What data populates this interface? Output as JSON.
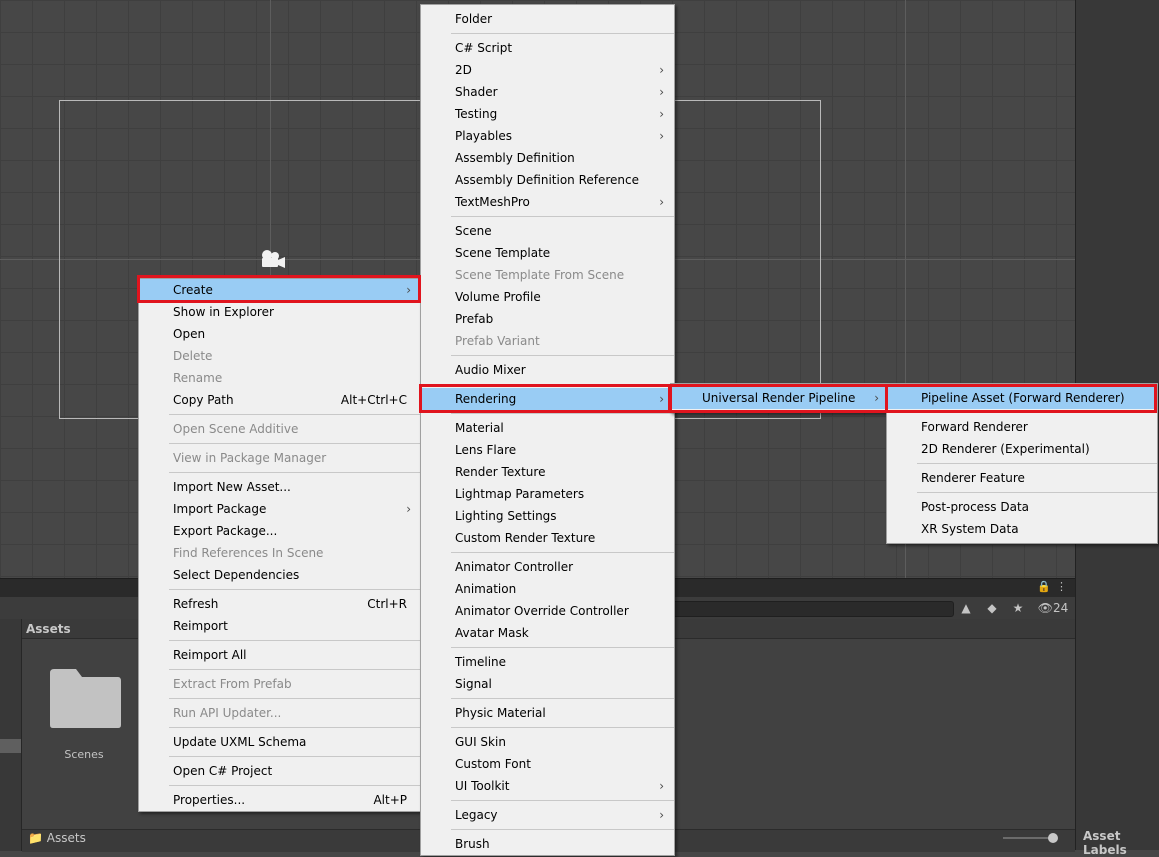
{
  "project": {
    "assets_title": "Assets",
    "folder_label": "Scenes",
    "bottom_path": "Assets",
    "hidden_count": "24"
  },
  "inspector": {
    "asset_labels": "Asset Labels"
  },
  "context_menu": {
    "items": [
      {
        "label": "Create",
        "arrow": "›",
        "state": "highlight"
      },
      {
        "label": "Show in Explorer"
      },
      {
        "label": "Open"
      },
      {
        "label": "Delete",
        "state": "disabled"
      },
      {
        "label": "Rename",
        "state": "disabled"
      },
      {
        "label": "Copy Path",
        "shortcut": "Alt+Ctrl+C"
      },
      {
        "sep": true
      },
      {
        "label": "Open Scene Additive",
        "state": "disabled"
      },
      {
        "sep": true
      },
      {
        "label": "View in Package Manager",
        "state": "disabled"
      },
      {
        "sep": true
      },
      {
        "label": "Import New Asset..."
      },
      {
        "label": "Import Package",
        "arrow": "›"
      },
      {
        "label": "Export Package..."
      },
      {
        "label": "Find References In Scene",
        "state": "disabled"
      },
      {
        "label": "Select Dependencies"
      },
      {
        "sep": true
      },
      {
        "label": "Refresh",
        "shortcut": "Ctrl+R"
      },
      {
        "label": "Reimport"
      },
      {
        "sep": true
      },
      {
        "label": "Reimport All"
      },
      {
        "sep": true
      },
      {
        "label": "Extract From Prefab",
        "state": "disabled"
      },
      {
        "sep": true
      },
      {
        "label": "Run API Updater...",
        "state": "disabled"
      },
      {
        "sep": true
      },
      {
        "label": "Update UXML Schema"
      },
      {
        "sep": true
      },
      {
        "label": "Open C# Project"
      },
      {
        "sep": true
      },
      {
        "label": "Properties...",
        "shortcut": "Alt+P"
      }
    ]
  },
  "create_menu": {
    "items": [
      {
        "label": "Folder"
      },
      {
        "sep": true
      },
      {
        "label": "C# Script"
      },
      {
        "label": "2D",
        "arrow": "›"
      },
      {
        "label": "Shader",
        "arrow": "›"
      },
      {
        "label": "Testing",
        "arrow": "›"
      },
      {
        "label": "Playables",
        "arrow": "›"
      },
      {
        "label": "Assembly Definition"
      },
      {
        "label": "Assembly Definition Reference"
      },
      {
        "label": "TextMeshPro",
        "arrow": "›"
      },
      {
        "sep": true
      },
      {
        "label": "Scene"
      },
      {
        "label": "Scene Template"
      },
      {
        "label": "Scene Template From Scene",
        "state": "disabled"
      },
      {
        "label": "Volume Profile"
      },
      {
        "label": "Prefab"
      },
      {
        "label": "Prefab Variant",
        "state": "disabled"
      },
      {
        "sep": true
      },
      {
        "label": "Audio Mixer"
      },
      {
        "sep": true
      },
      {
        "label": "Rendering",
        "arrow": "›",
        "state": "highlight"
      },
      {
        "sep": true
      },
      {
        "label": "Material"
      },
      {
        "label": "Lens Flare"
      },
      {
        "label": "Render Texture"
      },
      {
        "label": "Lightmap Parameters"
      },
      {
        "label": "Lighting Settings"
      },
      {
        "label": "Custom Render Texture"
      },
      {
        "sep": true
      },
      {
        "label": "Animator Controller"
      },
      {
        "label": "Animation"
      },
      {
        "label": "Animator Override Controller"
      },
      {
        "label": "Avatar Mask"
      },
      {
        "sep": true
      },
      {
        "label": "Timeline"
      },
      {
        "label": "Signal"
      },
      {
        "sep": true
      },
      {
        "label": "Physic Material"
      },
      {
        "sep": true
      },
      {
        "label": "GUI Skin"
      },
      {
        "label": "Custom Font"
      },
      {
        "label": "UI Toolkit",
        "arrow": "›"
      },
      {
        "sep": true
      },
      {
        "label": "Legacy",
        "arrow": "›"
      },
      {
        "sep": true
      },
      {
        "label": "Brush"
      }
    ]
  },
  "rendering_menu": {
    "items": [
      {
        "label": "Universal Render Pipeline",
        "arrow": "›",
        "state": "highlight"
      }
    ]
  },
  "urp_menu": {
    "items": [
      {
        "label": "Pipeline Asset (Forward Renderer)",
        "state": "highlight"
      },
      {
        "sep": true
      },
      {
        "label": "Forward Renderer"
      },
      {
        "label": "2D Renderer (Experimental)"
      },
      {
        "sep": true
      },
      {
        "label": "Renderer Feature"
      },
      {
        "sep": true
      },
      {
        "label": "Post-process Data"
      },
      {
        "label": "XR System Data"
      }
    ]
  }
}
